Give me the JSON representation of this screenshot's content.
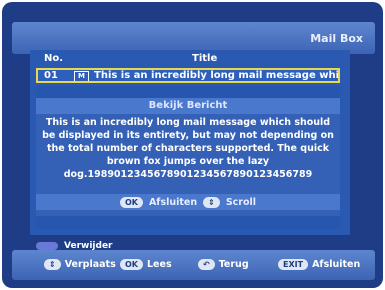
{
  "header": {
    "title": "Mail Box"
  },
  "columns": {
    "no": "No.",
    "title": "Title"
  },
  "rows": [
    {
      "num": "01",
      "icon": "M",
      "text": "This is an incredibly long mail message which s"
    }
  ],
  "popup": {
    "title": "Bekijk Bericht",
    "body": "This is an incredibly long mail message which should\nbe displayed in its entirety, but may not depending on\nthe total number of characters supported. The quick\nbrown fox jumps over the lazy\ndog.1989012345678901234567890123456789",
    "ok_key": "OK",
    "ok_label": "Afsluiten",
    "scroll_key": "⇕",
    "scroll_label": "Scroll"
  },
  "delete": {
    "label": "Verwijder",
    "color": "#6a78d8"
  },
  "footer": {
    "move_key": "⇕",
    "move_label": "Verplaats",
    "ok_key": "OK",
    "ok_label": "Lees",
    "back_key": "↶",
    "back_label": "Terug",
    "exit_key": "EXIT",
    "exit_label": "Afsluiten"
  }
}
